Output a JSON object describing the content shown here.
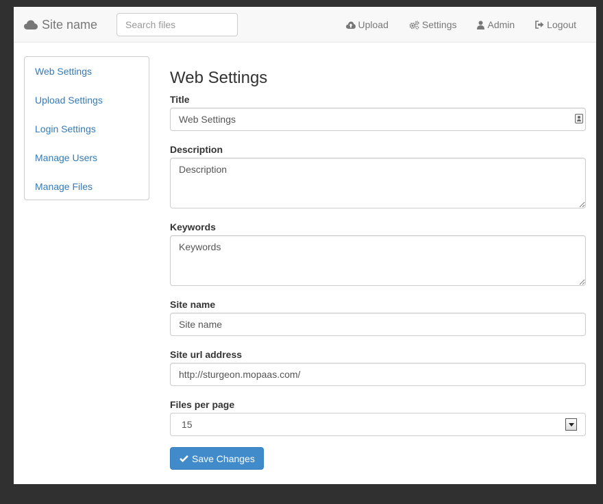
{
  "navbar": {
    "brand": "Site name",
    "search_placeholder": "Search files",
    "links": {
      "upload": "Upload",
      "settings": "Settings",
      "admin": "Admin",
      "logout": "Logout"
    },
    "icons": {
      "brand": "cloud-icon",
      "upload": "cloud-upload-icon",
      "settings": "cogs-icon",
      "admin": "user-icon",
      "logout": "logout-icon"
    }
  },
  "sidebar": {
    "items": [
      {
        "label": "Web Settings"
      },
      {
        "label": "Upload Settings"
      },
      {
        "label": "Login Settings"
      },
      {
        "label": "Manage Users"
      },
      {
        "label": "Manage Files"
      }
    ]
  },
  "main": {
    "title": "Web Settings",
    "fields": {
      "title": {
        "label": "Title",
        "value": "Web Settings"
      },
      "description": {
        "label": "Description",
        "placeholder": "Description"
      },
      "keywords": {
        "label": "Keywords",
        "placeholder": "Keywords"
      },
      "site_name": {
        "label": "Site name",
        "placeholder": "Site name"
      },
      "site_url": {
        "label": "Site url address",
        "value": "http://sturgeon.mopaas.com/"
      },
      "files_per_page": {
        "label": "Files per page",
        "selected": "15"
      }
    },
    "save_button": "Save Changes"
  },
  "colors": {
    "background": "#303030",
    "link": "#337ab7",
    "primary_button": "#428bca",
    "navbar_text": "#777777"
  }
}
